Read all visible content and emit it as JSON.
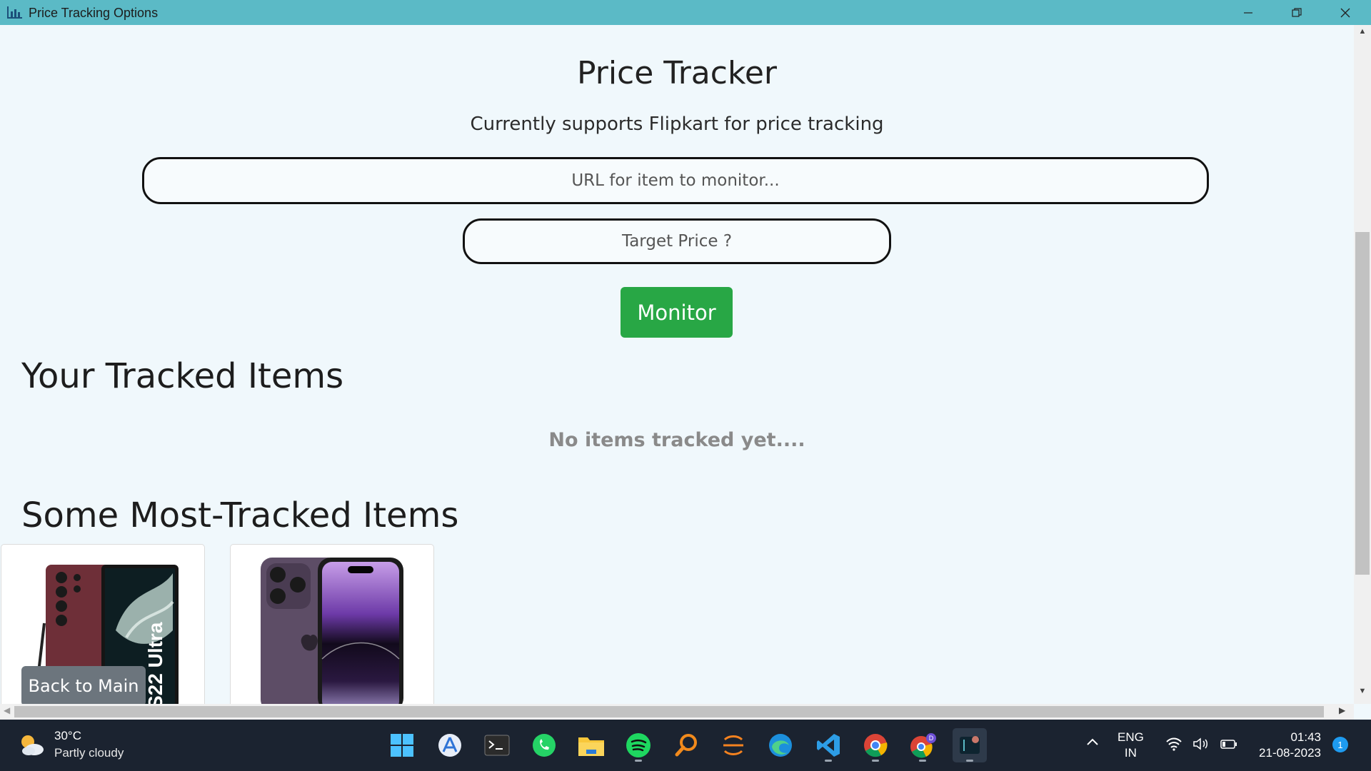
{
  "window": {
    "title": "Price Tracking Options",
    "icons": [
      "app-icon",
      "minimize-icon",
      "restore-icon",
      "close-icon"
    ]
  },
  "header": {
    "title": "Price Tracker",
    "subtitle": "Currently supports Flipkart for price tracking"
  },
  "form": {
    "url_placeholder": "URL for item to monitor...",
    "url_value": "",
    "price_placeholder": "Target Price ?",
    "price_value": "",
    "monitor_label": "Monitor"
  },
  "tracked": {
    "heading": "Your Tracked Items",
    "empty_message": "No items tracked yet...."
  },
  "most_tracked": {
    "heading": "Some Most-Tracked Items",
    "items": [
      {
        "image": "samsung-galaxy-s22-ultra-image"
      },
      {
        "image": "iphone-14-pro-image"
      }
    ]
  },
  "back_button": {
    "label": "Back to Main"
  },
  "taskbar": {
    "weather": {
      "temp": "30°C",
      "condition": "Partly cloudy"
    },
    "apps": [
      "windows-start-icon",
      "app-store-icon",
      "terminal-icon",
      "whatsapp-icon",
      "file-explorer-icon",
      "spotify-icon",
      "search-tool-icon",
      "eclipse-icon",
      "edge-icon",
      "vscode-icon",
      "chrome-icon",
      "chrome-profile-icon",
      "active-app-icon"
    ],
    "tray": {
      "lang_line1": "ENG",
      "lang_line2": "IN",
      "time": "01:43",
      "date": "21-08-2023",
      "notifications": "1"
    }
  },
  "colors": {
    "titlebar": "#5bbac6",
    "background": "#f0f8fc",
    "monitor_button": "#28a745",
    "back_button": "#6c757d",
    "taskbar": "#1b2330"
  }
}
